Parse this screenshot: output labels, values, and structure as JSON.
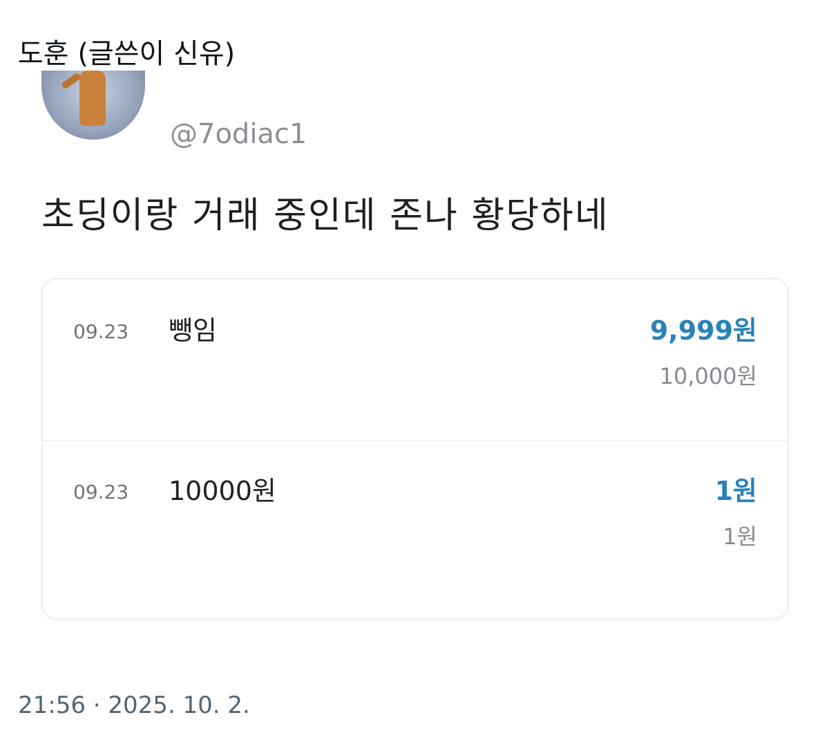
{
  "post": {
    "author": "도훈 (글쓴이 신유)",
    "timestamp": "21:56 · 2025. 10. 2."
  },
  "embedded": {
    "handle": "@7odiac1",
    "text": "초딩이랑 거래 중인데 존나 황당하네",
    "transactions": [
      {
        "date": "09.23",
        "description": "뺑임",
        "amount": "9,999원",
        "balance": "10,000원"
      },
      {
        "date": "09.23",
        "description": "10000원",
        "amount": "1원",
        "balance": "1원"
      }
    ]
  },
  "colors": {
    "amount": "#2a83b8",
    "balance": "#868b92",
    "timestamp": "#536471"
  }
}
